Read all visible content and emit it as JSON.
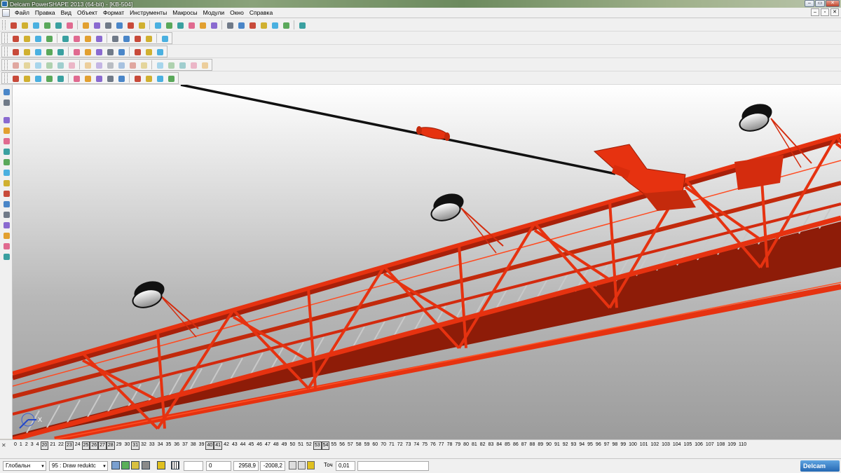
{
  "window": {
    "title": "Delcam PowerSHAPE 2013 (64-bit) - [KB-504]",
    "minimize": "‒",
    "restore": "▭",
    "close": "✕"
  },
  "menu": [
    "Файл",
    "Правка",
    "Вид",
    "Объект",
    "Формат",
    "Инструменты",
    "Макросы",
    "Модули",
    "Окно",
    "Справка"
  ],
  "mdi_controls": [
    "‒",
    "▫",
    "✕"
  ],
  "toolbars": {
    "row1_icons": [
      "new-icon",
      "open-icon",
      "open-folder-icon",
      "print-preview-icon",
      "save-icon",
      "print-icon",
      "import-icon",
      "cut-icon",
      "copy-icon",
      "paste-icon",
      "redo-icon",
      "delete-icon",
      "undo-icon",
      "undo2-icon",
      "select-icon",
      "wireframe-icon",
      "zoom-select-icon",
      "line-icon",
      "circle-icon",
      "curve-icon",
      "arc-icon",
      "light-icon",
      "shade-icon",
      "render-icon",
      "wand-icon"
    ],
    "row2_icons": [
      "view-top-icon",
      "view-front-icon",
      "view-iso-icon",
      "cube-icon",
      "view-all-icon",
      "zoom-icon",
      "zoom-in-icon",
      "zoom-out-icon",
      "globe-icon",
      "sphere-icon",
      "shading-icon",
      "light-bulb-icon",
      "hand-icon"
    ],
    "row3_icons": [
      "calc-icon",
      "table-icon",
      "doc-icon",
      "text-icon",
      "link-icon",
      "sphere-red-icon",
      "gem-icon",
      "arrow-icon",
      "cube-yellow-icon",
      "grid-icon",
      "info-icon",
      "graph-icon",
      "puzzle-icon"
    ],
    "row4_icons": [
      "wire1-icon",
      "wire2-icon",
      "wire3-icon",
      "wire4-icon",
      "wire5-icon",
      "wire6-icon",
      "curve1-icon",
      "curve2-icon",
      "curve3-icon",
      "curve4-icon",
      "curve5-icon",
      "curve6-icon",
      "curve7-icon",
      "curve8-icon",
      "curve9-icon",
      "curve10-icon",
      "box-icon"
    ],
    "row5_icons": [
      "surface1-icon",
      "surface2-icon",
      "solid1-icon",
      "solid2-icon",
      "solid3-icon",
      "solid4-icon",
      "solid5-icon",
      "solid6-icon",
      "solid7-icon",
      "solid8-icon",
      "solid9-icon",
      "solid10-icon",
      "solid11-icon",
      "solid12-icon"
    ]
  },
  "left_toolbar_icons": [
    "pointer-icon",
    "multi-select-icon",
    "surface-icon",
    "solid-icon",
    "copy-icon",
    "component-icon",
    "paint-icon",
    "layer-icon",
    "mesh-icon",
    "dimension-icon",
    "model-icon",
    "texture-icon",
    "planar-icon",
    "layer2-icon",
    "globe-icon",
    "shape-icon"
  ],
  "viewport": {
    "axis_x": "X"
  },
  "levels": {
    "close": "✕",
    "items": [
      {
        "n": "0"
      },
      {
        "n": "1"
      },
      {
        "n": "2"
      },
      {
        "n": "3"
      },
      {
        "n": "4"
      },
      {
        "n": "20",
        "on": true
      },
      {
        "n": "21"
      },
      {
        "n": "22"
      },
      {
        "n": "23",
        "on": true
      },
      {
        "n": "24"
      },
      {
        "n": "25",
        "on": true
      },
      {
        "n": "26",
        "on": true
      },
      {
        "n": "27",
        "on": true
      },
      {
        "n": "28",
        "on": true
      },
      {
        "n": "29"
      },
      {
        "n": "30"
      },
      {
        "n": "31",
        "on": true
      },
      {
        "n": "32"
      },
      {
        "n": "33"
      },
      {
        "n": "34"
      },
      {
        "n": "35"
      },
      {
        "n": "36"
      },
      {
        "n": "37"
      },
      {
        "n": "38"
      },
      {
        "n": "39"
      },
      {
        "n": "40",
        "on": true
      },
      {
        "n": "41",
        "on": true
      },
      {
        "n": "42"
      },
      {
        "n": "43"
      },
      {
        "n": "44"
      },
      {
        "n": "45"
      },
      {
        "n": "46"
      },
      {
        "n": "47"
      },
      {
        "n": "48"
      },
      {
        "n": "49"
      },
      {
        "n": "50"
      },
      {
        "n": "51"
      },
      {
        "n": "52"
      },
      {
        "n": "53",
        "on": true
      },
      {
        "n": "54",
        "on": true
      },
      {
        "n": "55"
      },
      {
        "n": "56"
      },
      {
        "n": "57"
      },
      {
        "n": "58"
      },
      {
        "n": "59"
      },
      {
        "n": "60"
      },
      {
        "n": "70"
      },
      {
        "n": "71"
      },
      {
        "n": "72"
      },
      {
        "n": "73"
      },
      {
        "n": "74"
      },
      {
        "n": "75"
      },
      {
        "n": "76"
      },
      {
        "n": "77"
      },
      {
        "n": "78"
      },
      {
        "n": "79"
      },
      {
        "n": "80"
      },
      {
        "n": "81"
      },
      {
        "n": "82"
      },
      {
        "n": "83"
      },
      {
        "n": "84"
      },
      {
        "n": "85"
      },
      {
        "n": "86"
      },
      {
        "n": "87"
      },
      {
        "n": "88"
      },
      {
        "n": "89"
      },
      {
        "n": "90"
      },
      {
        "n": "91"
      },
      {
        "n": "92"
      },
      {
        "n": "93"
      },
      {
        "n": "94"
      },
      {
        "n": "95"
      },
      {
        "n": "96"
      },
      {
        "n": "97"
      },
      {
        "n": "98"
      },
      {
        "n": "99"
      },
      {
        "n": "100"
      },
      {
        "n": "101"
      },
      {
        "n": "102"
      },
      {
        "n": "103"
      },
      {
        "n": "104"
      },
      {
        "n": "105"
      },
      {
        "n": "106"
      },
      {
        "n": "107"
      },
      {
        "n": "108"
      },
      {
        "n": "109"
      },
      {
        "n": "110"
      }
    ]
  },
  "status": {
    "workplane": "Глобальн",
    "level_number": "95",
    "level_name": ": Draw reduktc",
    "field_0": "0",
    "coord_x": "2958,9",
    "coord_y": "-2008,2",
    "tolerance_label": "Точ",
    "tolerance_value": "0,01",
    "brand": "Delcam"
  },
  "colors": {
    "truss": "#e63210",
    "truss_dark": "#a8200a",
    "cable": "#111111",
    "viewport_top": "#ffffff",
    "viewport_bottom": "#9c9c9c"
  }
}
